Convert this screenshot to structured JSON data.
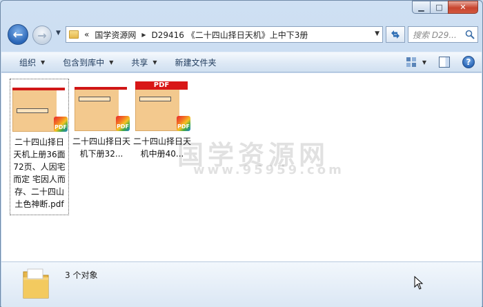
{
  "window": {
    "caption_buttons": {
      "minimize": "▁",
      "maximize": "□",
      "close": "✕"
    }
  },
  "nav": {
    "back_label": "←",
    "forward_label": "→",
    "path_segments": [
      "«",
      "国学资源网",
      "D29416 《二十四山择日天机》上中下3册"
    ],
    "search_placeholder": "搜索 D29..."
  },
  "toolbar": {
    "items": [
      {
        "label": "组织"
      },
      {
        "label": "包含到库中"
      },
      {
        "label": "共享"
      },
      {
        "label": "新建文件夹"
      }
    ],
    "help_label": "?"
  },
  "files": [
    {
      "name": "二十四山择日天机上册36面72页、人因宅而定 宅因人而存、二十四山土色神断.pdf",
      "badge": "PDF",
      "selected": true
    },
    {
      "name": "二十四山择日天机下册32...",
      "badge": "PDF",
      "selected": false
    },
    {
      "name": "二十四山择日天机中册40...",
      "badge": "PDF",
      "selected": false,
      "header": "PDF"
    }
  ],
  "watermark": {
    "main": "国学资源网",
    "sub": "www.95959.com"
  },
  "status": {
    "count_text": "3 个对象"
  },
  "colors": {
    "pdf_red": "#d81717",
    "paper": "#f3c98e",
    "accent": "#2a66b7"
  }
}
